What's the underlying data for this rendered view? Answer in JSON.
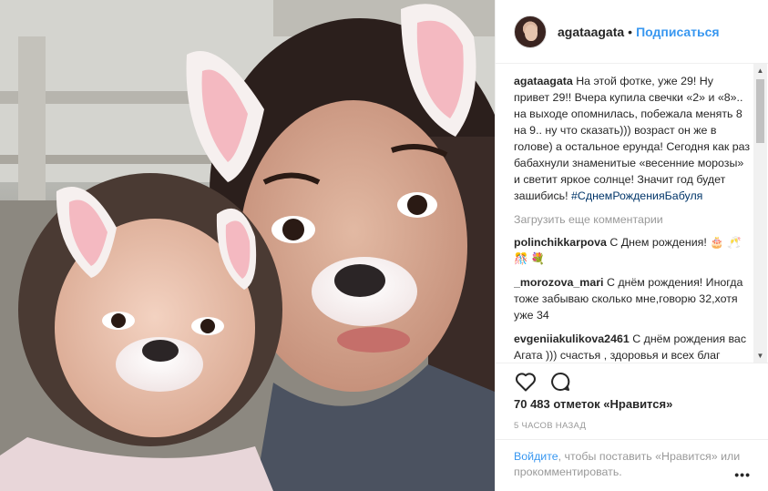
{
  "post": {
    "username": "agataagata",
    "separator": "•",
    "follow_label": "Подписаться"
  },
  "caption": {
    "username": "agataagata",
    "text": "На этой фотке, уже 29! Ну привет 29!! Вчера купила свечки «2» и «8».. на выходе опомнилась, побежала менять 8 на 9.. ну что сказать))) возраст он же в голове) а остальное ерунда! Сегодня как раз бабахнули знаменитые «весенние морозы» и светит яркое солнце! Значит год будет зашибись!",
    "hashtag": "#СднемРожденияБабуля"
  },
  "load_more_label": "Загрузить еще комментарии",
  "comments": [
    {
      "username": "polinchikkarpova",
      "text": "С Днем рождения! 🎂 🥂 🎊 💐"
    },
    {
      "username": "_morozova_mari",
      "text": "С днём рождения! Иногда тоже забываю сколько мне,говорю 32,хотя уже 34"
    },
    {
      "username": "evgeniiakulikova2461",
      "text": "С днём рождения вас Агата ))) счастья , здоровья и всех благ"
    }
  ],
  "likes_text": "70 483 отметок «Нравится»",
  "time_text": "5 ЧАСОВ НАЗАД",
  "footer": {
    "login_label": "Войдите",
    "rest": ", чтобы поставить «Нравится» или прокомментировать.",
    "more_label": "•••"
  },
  "icons": {
    "like": "heart-icon",
    "comment": "comment-bubble-icon",
    "more": "more-dots-icon"
  },
  "colors": {
    "link": "#3897f0",
    "hashtag": "#003569",
    "muted": "#999999",
    "text": "#262626"
  }
}
